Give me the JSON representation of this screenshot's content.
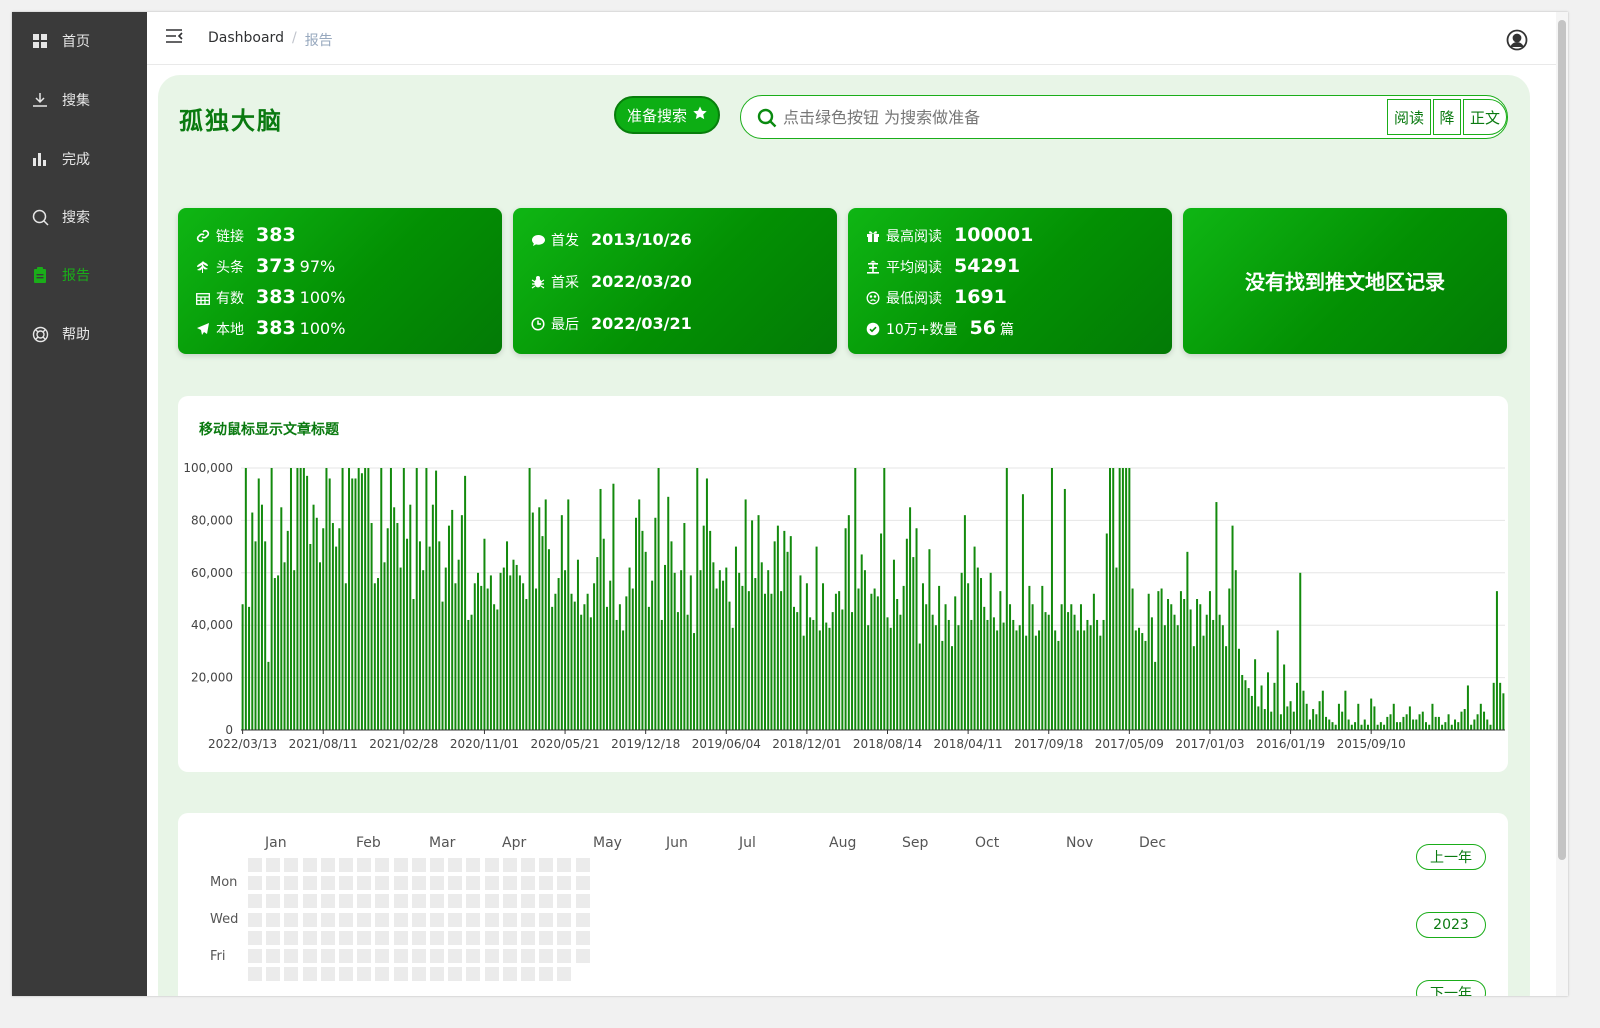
{
  "sidebar": {
    "items": [
      {
        "label": "首页",
        "icon": "grid-icon"
      },
      {
        "label": "搜集",
        "icon": "download-icon"
      },
      {
        "label": "完成",
        "icon": "bar-chart-icon"
      },
      {
        "label": "搜索",
        "icon": "search-icon"
      },
      {
        "label": "报告",
        "icon": "clipboard-icon",
        "active": true
      },
      {
        "label": "帮助",
        "icon": "lifebuoy-icon"
      }
    ]
  },
  "header": {
    "breadcrumb_home": "Dashboard",
    "breadcrumb_sep": "/",
    "breadcrumb_current": "报告"
  },
  "page": {
    "title": "孤独大脑",
    "prepare_button": "准备搜索",
    "search_placeholder": "点击绿色按钮 为搜索做准备",
    "search_btn_read": "阅读",
    "search_btn_desc": "降",
    "search_btn_body": "正文"
  },
  "cards": {
    "links": {
      "link_label": "链接",
      "link_value": "383",
      "head_label": "头条",
      "head_value": "373",
      "head_pct": "97%",
      "valid_label": "有数",
      "valid_value": "383",
      "valid_pct": "100%",
      "local_label": "本地",
      "local_value": "383",
      "local_pct": "100%"
    },
    "dates": {
      "first_pub_label": "首发",
      "first_pub_value": "2013/10/26",
      "first_col_label": "首采",
      "first_col_value": "2022/03/20",
      "last_label": "最后",
      "last_value": "2022/03/21"
    },
    "reads": {
      "max_label": "最高阅读",
      "max_value": "100001",
      "avg_label": "平均阅读",
      "avg_value": "54291",
      "min_label": "最低阅读",
      "min_value": "1691",
      "count_label": "10万+数量",
      "count_value": "56",
      "count_unit": "篇"
    },
    "region_message": "没有找到推文地区记录"
  },
  "chart_data": {
    "type": "bar",
    "title": "移动鼠标显示文章标题",
    "xlabel": "",
    "ylabel": "",
    "ylim": [
      0,
      100000
    ],
    "yticks": [
      "0",
      "20,000",
      "40,000",
      "60,000",
      "80,000",
      "100,000"
    ],
    "xtick_labels": [
      "2022/03/13",
      "2021/08/11",
      "2021/02/28",
      "2020/11/01",
      "2020/05/21",
      "2019/12/18",
      "2019/06/04",
      "2018/12/01",
      "2018/08/14",
      "2018/04/11",
      "2017/09/18",
      "2017/05/09",
      "2017/01/03",
      "2016/01/19",
      "2015/09/10"
    ],
    "color": "#138a0d",
    "grid": true,
    "series": [
      {
        "values": [
          48000,
          100000,
          47000,
          83000,
          72000,
          96000,
          86000,
          72000,
          26000,
          100000,
          58000,
          59000,
          85000,
          64000,
          76000,
          100000,
          61000,
          100000,
          100000,
          100000,
          97000,
          71000,
          86000,
          81000,
          64000,
          77000,
          100000,
          96000,
          79000,
          70000,
          77000,
          100000,
          56000,
          100000,
          96000,
          96000,
          100000,
          98000,
          100000,
          100000,
          79000,
          56000,
          58000,
          100000,
          64000,
          77000,
          100000,
          85000,
          79000,
          62000,
          100000,
          73000,
          86000,
          50000,
          100000,
          72000,
          61000,
          100000,
          70000,
          86000,
          99000,
          72000,
          49000,
          62000,
          78000,
          84000,
          56000,
          65000,
          82000,
          97000,
          42000,
          44000,
          56000,
          60000,
          55000,
          73000,
          54000,
          59000,
          48000,
          46000,
          60000,
          62000,
          72000,
          59000,
          65000,
          63000,
          59000,
          56000,
          50000,
          100000,
          83000,
          54000,
          85000,
          74000,
          88000,
          69000,
          47000,
          52000,
          58000,
          82000,
          61000,
          88000,
          52000,
          49000,
          65000,
          44000,
          48000,
          52000,
          43000,
          56000,
          66000,
          92000,
          73000,
          47000,
          57000,
          94000,
          42000,
          48000,
          38000,
          51000,
          62000,
          54000,
          81000,
          88000,
          76000,
          68000,
          47000,
          57000,
          81000,
          100000,
          42000,
          63000,
          89000,
          72000,
          60000,
          45000,
          61000,
          79000,
          44000,
          59000,
          37000,
          100000,
          61000,
          78000,
          96000,
          76000,
          64000,
          54000,
          61000,
          57000,
          62000,
          49000,
          39000,
          70000,
          60000,
          55000,
          88000,
          53000,
          80000,
          58000,
          82000,
          64000,
          52000,
          61000,
          52000,
          72000,
          78000,
          53000,
          76000,
          68000,
          74000,
          47000,
          45000,
          59000,
          36000,
          56000,
          43000,
          42000,
          70000,
          38000,
          56000,
          41000,
          39000,
          45000,
          52000,
          53000,
          46000,
          77000,
          82000,
          45000,
          100000,
          54000,
          67000,
          61000,
          40000,
          52000,
          54000,
          51000,
          75000,
          100000,
          43000,
          39000,
          65000,
          50000,
          44000,
          55000,
          73000,
          85000,
          66000,
          77000,
          33000,
          56000,
          48000,
          69000,
          44000,
          40000,
          55000,
          34000,
          48000,
          42000,
          32000,
          51000,
          40000,
          60000,
          82000,
          56000,
          42000,
          70000,
          62000,
          58000,
          47000,
          42000,
          60000,
          43000,
          38000,
          53000,
          41000,
          100000,
          48000,
          42000,
          38000,
          40000,
          90000,
          36000,
          55000,
          48000,
          36000,
          38000,
          55000,
          45000,
          44000,
          100000,
          38000,
          34000,
          48000,
          92000,
          45000,
          48000,
          44000,
          38000,
          48000,
          38000,
          42000,
          40000,
          52000,
          42000,
          36000,
          42000,
          75000,
          100000,
          100000,
          62000,
          100000,
          100000,
          100000,
          100000,
          54000,
          38000,
          39000,
          37000,
          34000,
          52000,
          43000,
          26000,
          53000,
          54000,
          40000,
          50000,
          48000,
          44000,
          40000,
          53000,
          50000,
          68000,
          46000,
          32000,
          50000,
          48000,
          36000,
          44000,
          53000,
          42000,
          87000,
          44000,
          40000,
          32000,
          54000,
          78000,
          61000,
          31000,
          21000,
          19000,
          16000,
          13000,
          27000,
          9000,
          17000,
          8000,
          22000,
          7000,
          18000,
          38000,
          6000,
          25000,
          9000,
          11000,
          7000,
          18000,
          60000,
          15000,
          10000,
          4000,
          8000,
          6000,
          11000,
          15000,
          5000,
          4000,
          3000,
          2000,
          10000,
          7000,
          15000,
          4000,
          2000,
          3000,
          10000,
          2000,
          4000,
          2000,
          12000,
          9000,
          2000,
          3000,
          2000,
          5000,
          6000,
          10000,
          3000,
          3000,
          5000,
          6000,
          9000,
          4000,
          4000,
          6000,
          7000,
          3000,
          2000,
          10000,
          5000,
          5000,
          2000,
          3000,
          6000,
          2000,
          4000,
          3000,
          7000,
          8000,
          17000,
          2000,
          4000,
          6000,
          10000,
          7000,
          4000,
          2000,
          18000,
          53000,
          18000,
          14000
        ]
      }
    ]
  },
  "heatmap": {
    "months": [
      "Jan",
      "Feb",
      "Mar",
      "Apr",
      "May",
      "Jun",
      "Jul",
      "Aug",
      "Sep",
      "Oct",
      "Nov",
      "Dec"
    ],
    "days": [
      "Mon",
      "Wed",
      "Fri"
    ],
    "prev_year": "上一年",
    "year": "2023",
    "next_year": "下一年"
  }
}
